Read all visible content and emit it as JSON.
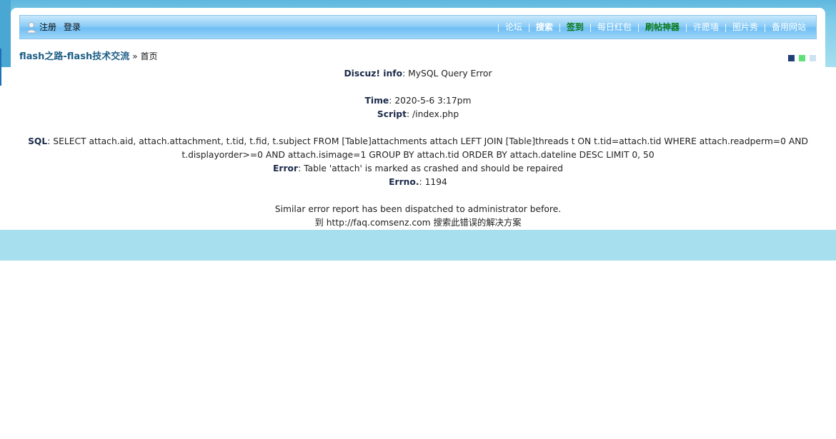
{
  "header": {
    "register": "注册",
    "login": "登录",
    "nav": [
      {
        "label": "论坛",
        "style": "normal"
      },
      {
        "label": "搜索",
        "style": "bold"
      },
      {
        "label": "签到",
        "style": "green"
      },
      {
        "label": "每日红包",
        "style": "normal"
      },
      {
        "label": "刷帖神器",
        "style": "green"
      },
      {
        "label": "许愿墙",
        "style": "normal"
      },
      {
        "label": "图片秀",
        "style": "normal"
      },
      {
        "label": "备用网站",
        "style": "normal"
      }
    ]
  },
  "breadcrumb": {
    "site": "flash之路-flash技术交流",
    "separator": "»",
    "current": "首页"
  },
  "style_colors": [
    "#1f3f77",
    "#5fe17a",
    "#cde3ef"
  ],
  "error": {
    "info_label": "Discuz! info",
    "info_value": ": MySQL Query Error",
    "time_label": "Time",
    "time_value": ": 2020-5-6 3:17pm",
    "script_label": "Script",
    "script_value": ": /index.php",
    "sql_label": "SQL",
    "sql_value_1": ": SELECT attach.aid, attach.attachment, t.tid, t.fid, t.subject FROM [Table]attachments attach LEFT JOIN [Table]threads t ON t.tid=attach.tid WHERE attach.readperm=0 AND",
    "sql_value_2": "t.displayorder>=0 AND attach.isimage=1 GROUP BY attach.tid ORDER BY attach.dateline DESC LIMIT 0, 50",
    "error_label": "Error",
    "error_value": ": Table 'attach' is marked as crashed and should be repaired",
    "errno_label": "Errno.",
    "errno_value": ": 1194",
    "dispatched": "Similar error report has been dispatched to administrator before.",
    "faq_prefix": "到",
    "faq_link": "http://faq.comsenz.com",
    "faq_suffix": "搜索此错误的解决方案"
  }
}
